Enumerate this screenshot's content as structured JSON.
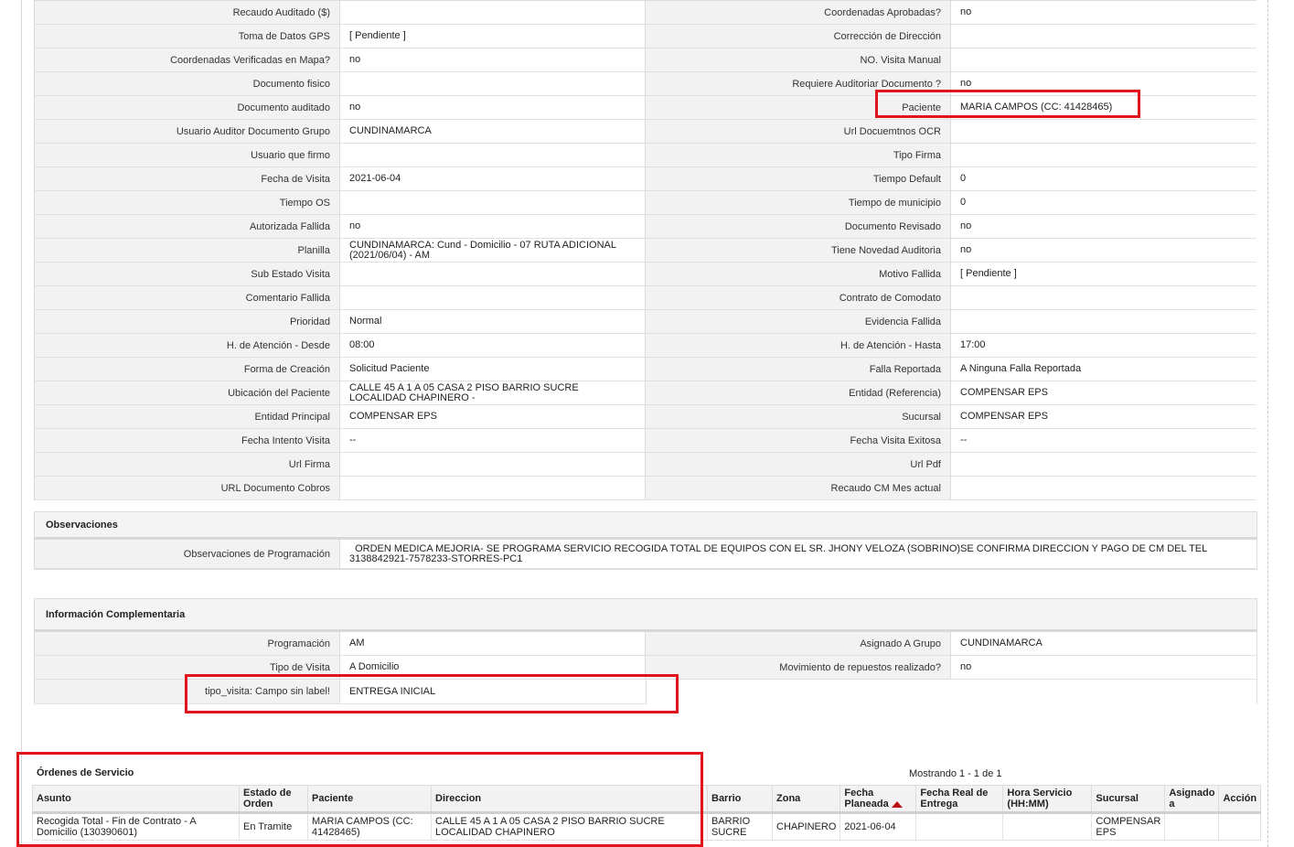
{
  "details": [
    {
      "l1": "Recaudo Auditado ($)",
      "v1": "",
      "l2": "Coordenadas Aprobadas?",
      "v2": "no"
    },
    {
      "l1": "Toma de Datos GPS",
      "v1": "[ Pendiente ]",
      "l2": "Corrección de Dirección",
      "v2": ""
    },
    {
      "l1": "Coordenadas Verificadas en Mapa?",
      "v1": "no",
      "l2": "NO. Visita Manual",
      "v2": ""
    },
    {
      "l1": "Documento fisico",
      "v1": "",
      "l2": "Requiere Auditoriar Documento ?",
      "v2": "no"
    },
    {
      "l1": "Documento auditado",
      "v1": "no",
      "l2": "Paciente",
      "v2": "MARIA CAMPOS (CC: 41428465)"
    },
    {
      "l1": "Usuario Auditor Documento Grupo",
      "v1": "CUNDINAMARCA",
      "l2": "Url Docuemtnos OCR",
      "v2": ""
    },
    {
      "l1": "Usuario que firmo",
      "v1": "",
      "l2": "Tipo Firma",
      "v2": ""
    },
    {
      "l1": "Fecha de Visita",
      "v1": "2021-06-04",
      "l2": "Tiempo Default",
      "v2": "0"
    },
    {
      "l1": "Tiempo OS",
      "v1": "",
      "l2": "Tiempo de municipio",
      "v2": "0"
    },
    {
      "l1": "Autorizada Fallida",
      "v1": "no",
      "l2": "Documento Revisado",
      "v2": "no"
    },
    {
      "l1": "Planilla",
      "v1": "CUNDINAMARCA: Cund - Domicilio - 07 RUTA ADICIONAL",
      "v1b": "(2021/06/04) - AM",
      "l2": "Tiene Novedad Auditoria",
      "v2": "no"
    },
    {
      "l1": "Sub Estado Visita",
      "v1": "",
      "l2": "Motivo Fallida",
      "v2": "[ Pendiente ]"
    },
    {
      "l1": "Comentario Fallida",
      "v1": "",
      "l2": "Contrato de Comodato",
      "v2": ""
    },
    {
      "l1": "Prioridad",
      "v1": "Normal",
      "l2": "Evidencia Fallida",
      "v2": ""
    },
    {
      "l1": "H. de Atención - Desde",
      "v1": "08:00",
      "l2": "H. de Atención - Hasta",
      "v2": "17:00"
    },
    {
      "l1": "Forma de Creación",
      "v1": "Solicitud Paciente",
      "l2": "Falla Reportada",
      "v2": "A Ninguna Falla Reportada"
    },
    {
      "l1": "Ubicación del Paciente",
      "v1": "CALLE 45 A 1 A 05 CASA 2 PISO BARRIO SUCRE",
      "v1b": "LOCALIDAD CHAPINERO -",
      "l2": "Entidad (Referencia)",
      "v2": "COMPENSAR EPS"
    },
    {
      "l1": "Entidad Principal",
      "v1": "COMPENSAR EPS",
      "l2": "Sucursal",
      "v2": "COMPENSAR EPS"
    },
    {
      "l1": "Fecha Intento Visita",
      "v1": "--",
      "l2": "Fecha Visita Exitosa",
      "v2": "--"
    },
    {
      "l1": "Url Firma",
      "v1": "",
      "l2": "Url Pdf",
      "v2": ""
    },
    {
      "l1": "URL Documento Cobros",
      "v1": "",
      "l2": "Recaudo CM Mes actual",
      "v2": ""
    }
  ],
  "observaciones": {
    "title": "Observaciones",
    "label": "Observaciones de Programación",
    "line1": "  ORDEN MEDICA MEJORIA- SE PROGRAMA SERVICIO RECOGIDA TOTAL DE EQUIPOS CON EL SR. JHONY VELOZA (SOBRINO)SE CONFIRMA DIRECCION Y PAGO DE CM DEL TEL",
    "line2": "3138842921-7578233-STORRES-PC1"
  },
  "info": {
    "title": "Información Complementaria",
    "rows": [
      {
        "l1": "Programación",
        "v1": "AM",
        "l2": "Asignado A Grupo",
        "v2": "CUNDINAMARCA"
      },
      {
        "l1": "Tipo de Visita",
        "v1": "A Domicilio",
        "l2": "Movimiento de repuestos realizado?",
        "v2": "no"
      }
    ],
    "extra": {
      "l1": "tipo_visita: Campo sin label!",
      "v1": "ENTREGA INICIAL"
    }
  },
  "orders": {
    "title": "Órdenes de Servicio",
    "showing": "Mostrando 1 - 1 de 1",
    "headers": {
      "asunto": "Asunto",
      "estado1": "Estado de",
      "estado2": "Orden",
      "paciente": "Paciente",
      "direccion": "Direccion",
      "barrio": "Barrio",
      "zona": "Zona",
      "fecha1": "Fecha",
      "fecha2": "Planeada",
      "fechar1": "Fecha Real de",
      "fechar2": "Entrega",
      "hora1": "Hora Servicio",
      "hora2": "(HH:MM)",
      "sucursal": "Sucursal",
      "asig1": "Asignado",
      "asig2": "a",
      "accion": "Acción"
    },
    "row": {
      "asunto1": "Recogida Total - Fin de Contrato - A",
      "asunto2": "Domicilio (130390601)",
      "estado": "En Tramite",
      "paciente1": "MARIA CAMPOS (CC:",
      "paciente2": "41428465)",
      "dir1": "CALLE 45 A 1 A 05 CASA 2 PISO BARRIO SUCRE",
      "dir2": "LOCALIDAD CHAPINERO",
      "barrio1": "BARRIO",
      "barrio2": "SUCRE",
      "zona": "CHAPINERO",
      "fecha": "2021-06-04",
      "fechar": "",
      "hora": "",
      "suc1": "COMPENSAR",
      "suc2": "EPS",
      "asig": "",
      "accion": ""
    }
  }
}
